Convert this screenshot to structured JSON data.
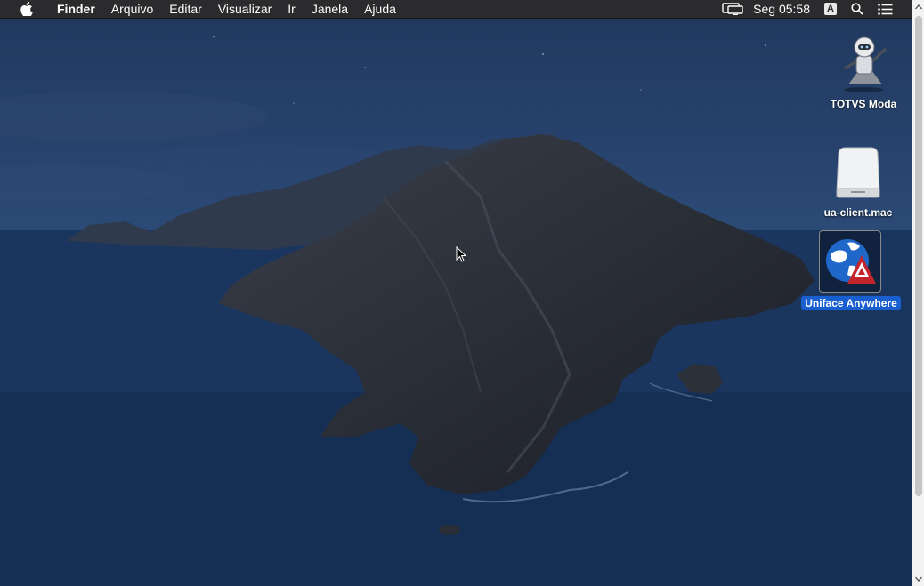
{
  "menubar": {
    "app_name": "Finder",
    "menus": [
      "Arquivo",
      "Editar",
      "Visualizar",
      "Ir",
      "Janela",
      "Ajuda"
    ],
    "clock": "Seg 05:58",
    "input_source": "A",
    "icons": [
      "apple-icon",
      "display-mirroring-icon",
      "input-source-icon",
      "spotlight-search-icon",
      "notification-center-icon"
    ]
  },
  "desktop": {
    "icons": [
      {
        "label": "TOTVS Moda",
        "icon": "automator-robot-icon",
        "selected": false
      },
      {
        "label": "ua-client.mac",
        "icon": "disk-image-icon",
        "selected": false
      },
      {
        "label": "Uniface Anywhere",
        "icon": "uniface-globe-icon",
        "selected": true
      }
    ]
  },
  "scrollbar": {
    "icons": [
      "scroll-up-arrow-icon",
      "scroll-down-arrow-icon"
    ]
  },
  "colors": {
    "menubar_bg": "#2b2b2d",
    "selection_blue": "#1a5fd0",
    "ocean": "#1b3761"
  }
}
